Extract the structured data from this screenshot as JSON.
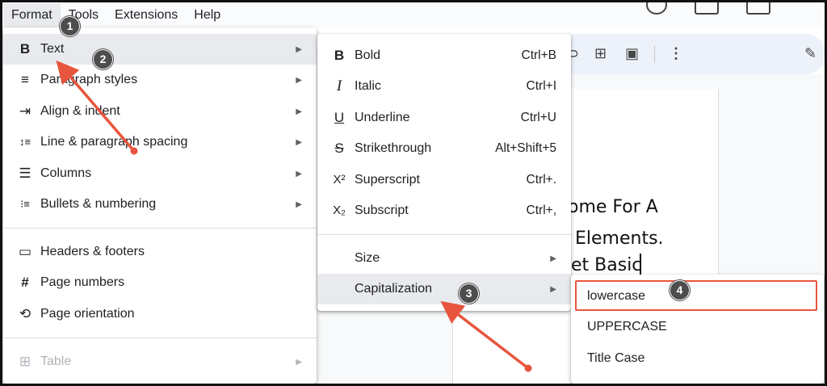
{
  "menubar": {
    "items": [
      "Format",
      "Tools",
      "Extensions",
      "Help"
    ]
  },
  "format_menu": {
    "items": [
      {
        "icon": "B",
        "icon_name": "bold-text-icon",
        "label": "Text"
      },
      {
        "icon": "≡",
        "icon_name": "paragraph-styles-icon",
        "label": "Paragraph styles"
      },
      {
        "icon": "⇥",
        "icon_name": "align-indent-icon",
        "label": "Align & indent"
      },
      {
        "icon": "↕≡",
        "icon_name": "line-spacing-icon",
        "label": "Line & paragraph spacing"
      },
      {
        "icon": "☰",
        "icon_name": "columns-icon",
        "label": "Columns"
      },
      {
        "icon": "⁝≡",
        "icon_name": "bullets-icon",
        "label": "Bullets & numbering"
      },
      {
        "icon": "▭",
        "icon_name": "headers-footers-icon",
        "label": "Headers & footers"
      },
      {
        "icon": "#",
        "icon_name": "page-numbers-icon",
        "label": "Page numbers"
      },
      {
        "icon": "⟲",
        "icon_name": "page-orientation-icon",
        "label": "Page orientation"
      },
      {
        "icon": "⊞",
        "icon_name": "table-icon",
        "label": "Table"
      }
    ]
  },
  "text_menu": {
    "items": [
      {
        "icon": "B",
        "icon_name": "bold-icon",
        "label": "Bold",
        "shortcut": "Ctrl+B"
      },
      {
        "icon": "I",
        "icon_name": "italic-icon",
        "label": "Italic",
        "shortcut": "Ctrl+I"
      },
      {
        "icon": "U",
        "icon_name": "underline-icon",
        "label": "Underline",
        "shortcut": "Ctrl+U"
      },
      {
        "icon": "S",
        "icon_name": "strikethrough-icon",
        "label": "Strikethrough",
        "shortcut": "Alt+Shift+5"
      },
      {
        "icon": "X²",
        "icon_name": "superscript-icon",
        "label": "Superscript",
        "shortcut": "Ctrl+."
      },
      {
        "icon": "X₂",
        "icon_name": "subscript-icon",
        "label": "Subscript",
        "shortcut": "Ctrl+,"
      },
      {
        "label": "Size"
      },
      {
        "label": "Capitalization"
      }
    ]
  },
  "capitalization_menu": {
    "items": [
      "lowercase",
      "UPPERCASE",
      "Title Case"
    ]
  },
  "document": {
    "lines": [
      "ome For A",
      "Elements.",
      "et Basic"
    ]
  },
  "annotations": {
    "badges": [
      "1",
      "2",
      "3",
      "4"
    ],
    "color": "#e8553e"
  },
  "colors": {
    "highlight": "#e8eaed",
    "toolbar": "#edf2fa",
    "disabled": "#b0b3b8"
  }
}
